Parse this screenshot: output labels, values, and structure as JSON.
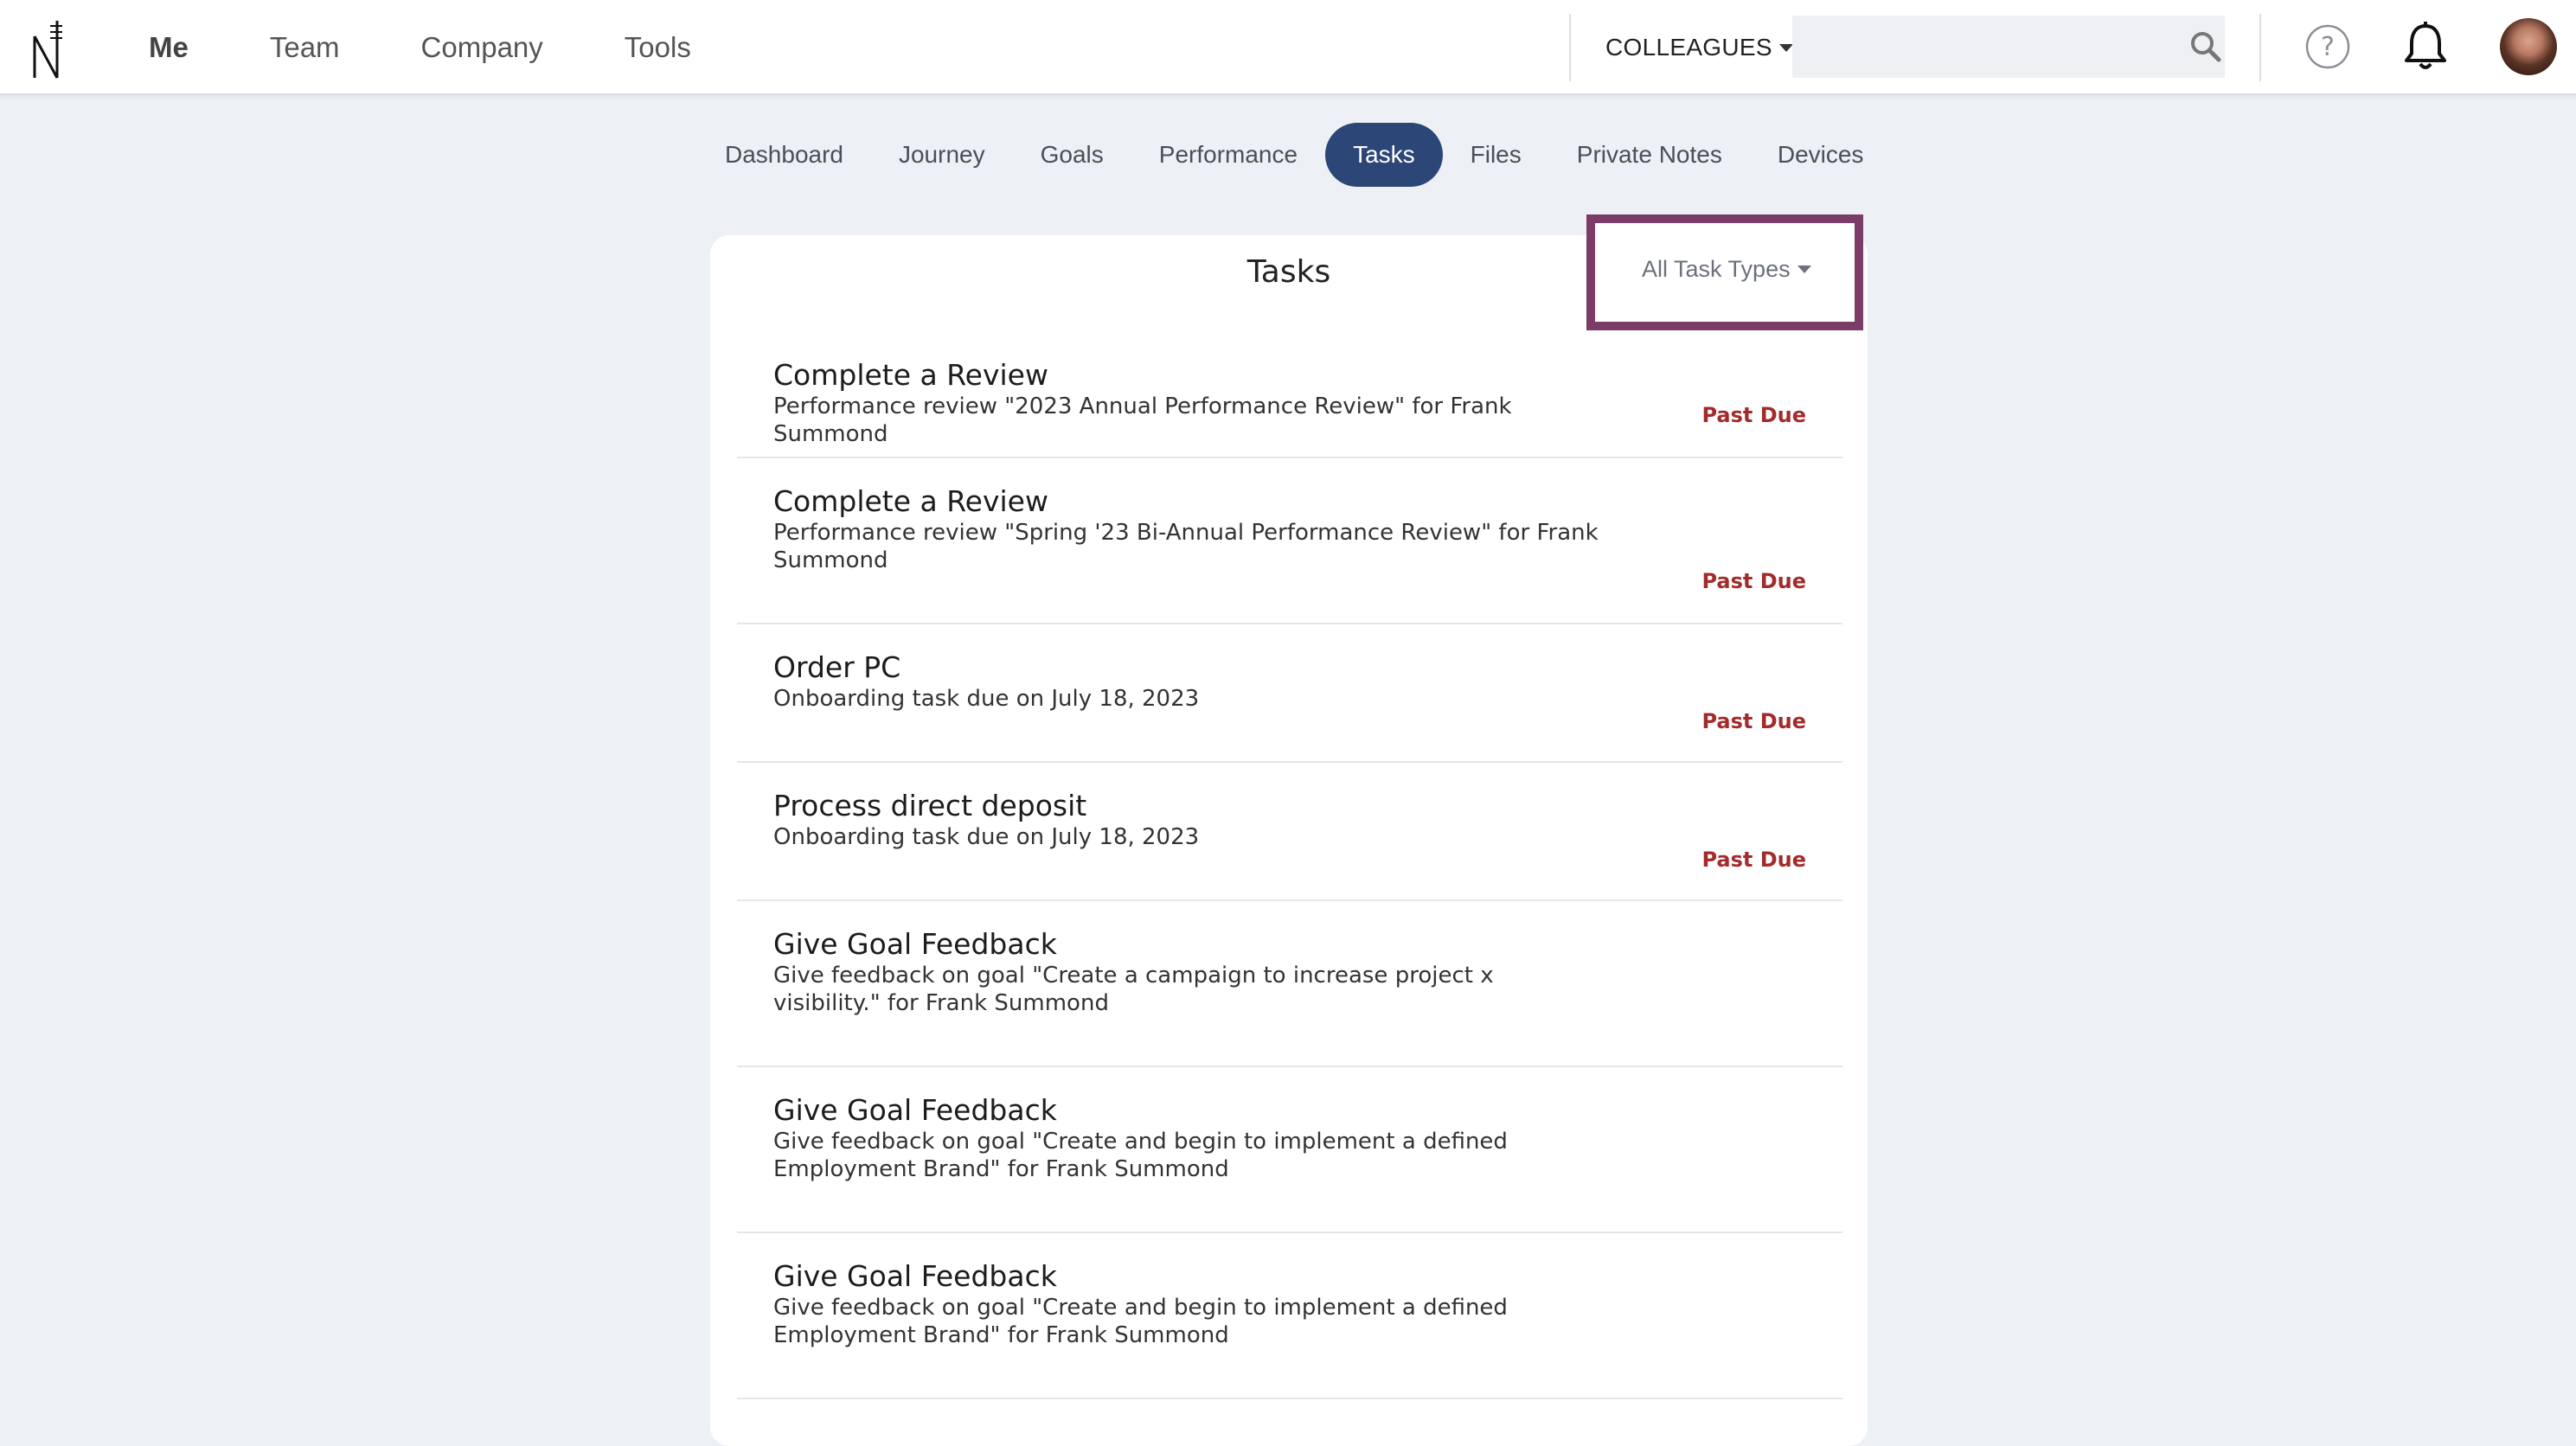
{
  "header": {
    "nav": [
      "Me",
      "Team",
      "Company",
      "Tools"
    ],
    "active_nav": "Me",
    "colleagues_label": "COLLEAGUES",
    "search_value": ""
  },
  "subnav": {
    "tabs": [
      "Dashboard",
      "Journey",
      "Goals",
      "Performance",
      "Tasks",
      "Files",
      "Private Notes",
      "Devices"
    ],
    "active_tab": "Tasks"
  },
  "tasks_panel": {
    "title": "Tasks",
    "filter_label": "All Task Types",
    "items": [
      {
        "title": "Complete a Review",
        "description": "Performance review \"2023 Annual Performance Review\" for Frank Summond",
        "status": "Past Due"
      },
      {
        "title": "Complete a Review",
        "description": "Performance review \"Spring '23 Bi-Annual Performance Review\" for Frank Summond",
        "status": "Past Due"
      },
      {
        "title": "Order PC",
        "description": "Onboarding task due on July 18, 2023",
        "status": "Past Due"
      },
      {
        "title": "Process direct deposit",
        "description": "Onboarding task due on July 18, 2023",
        "status": "Past Due"
      },
      {
        "title": "Give Goal Feedback",
        "description": "Give feedback on goal \"Create a campaign to increase project x visibility.\" for Frank Summond",
        "status": ""
      },
      {
        "title": "Give Goal Feedback",
        "description": "Give feedback on goal \"Create and begin to implement a defined Employment Brand\" for Frank Summond",
        "status": ""
      },
      {
        "title": "Give Goal Feedback",
        "description": "Give feedback on goal \"Create and begin to implement a defined Employment Brand\" for Frank Summond",
        "status": ""
      }
    ]
  },
  "colors": {
    "accent": "#2b4677",
    "highlight_border": "#7b3c68",
    "past_due": "#a32b2b",
    "background": "#edf0f4"
  },
  "icons": [
    "app-logo-icon",
    "search-icon",
    "help-icon",
    "bell-icon",
    "avatar"
  ]
}
